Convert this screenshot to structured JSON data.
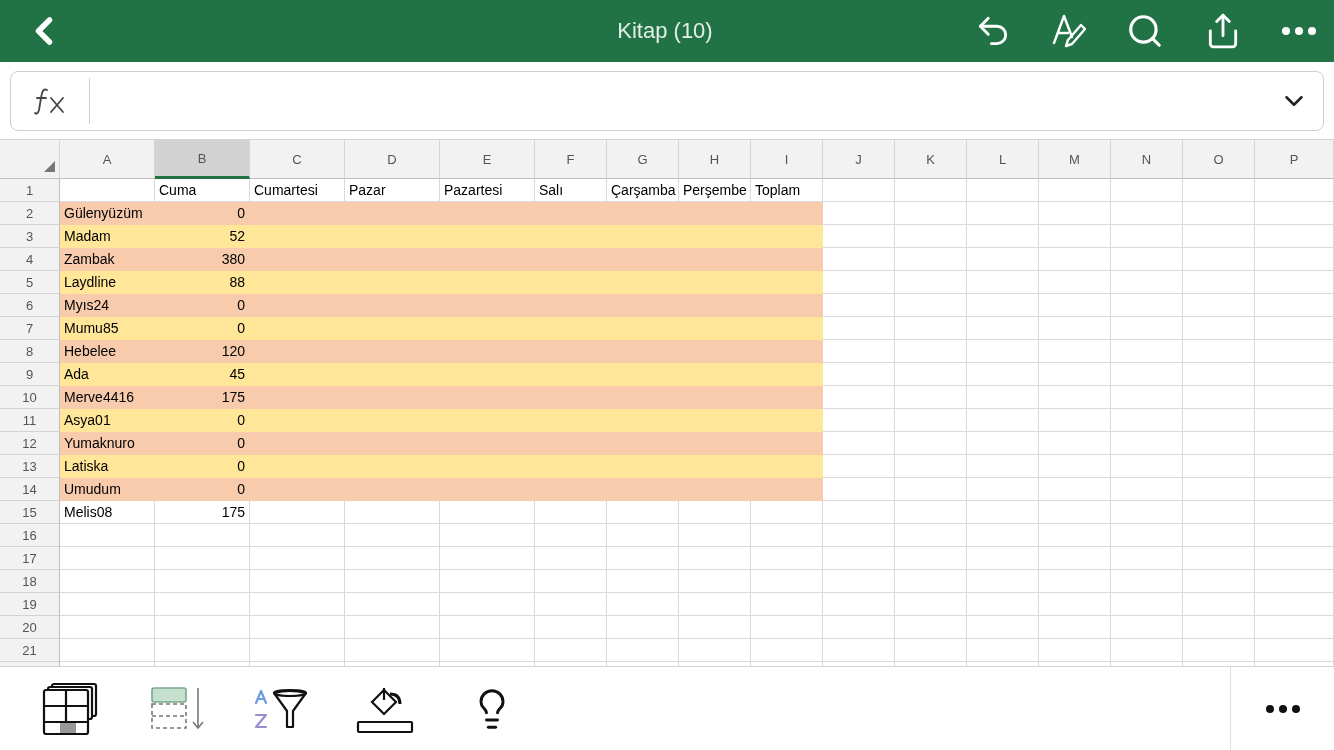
{
  "title": "Kitap (10)",
  "columns": [
    {
      "label": "A",
      "selected": false
    },
    {
      "label": "B",
      "selected": true
    },
    {
      "label": "C",
      "selected": false
    },
    {
      "label": "D",
      "selected": false
    },
    {
      "label": "E",
      "selected": false
    },
    {
      "label": "F",
      "selected": false
    },
    {
      "label": "G",
      "selected": false
    },
    {
      "label": "H",
      "selected": false
    },
    {
      "label": "I",
      "selected": false
    },
    {
      "label": "J",
      "selected": false
    },
    {
      "label": "K",
      "selected": false
    },
    {
      "label": "L",
      "selected": false
    },
    {
      "label": "M",
      "selected": false
    },
    {
      "label": "N",
      "selected": false
    },
    {
      "label": "O",
      "selected": false
    },
    {
      "label": "P",
      "selected": false
    }
  ],
  "header_row": {
    "number": "1",
    "labels": [
      "Cuma",
      "Cumartesi",
      "Pazar",
      "Pazartesi",
      "Salı",
      "Çarşamba",
      "Perşembe",
      "Toplam"
    ]
  },
  "rows": [
    {
      "number": "2",
      "color": "#f8cbad",
      "name": "Gülenyüzüm",
      "value": "0"
    },
    {
      "number": "3",
      "color": "#ffe699",
      "name": "Madam",
      "value": "52"
    },
    {
      "number": "4",
      "color": "#f8cbad",
      "name": "Zambak",
      "value": "380"
    },
    {
      "number": "5",
      "color": "#ffe699",
      "name": "Laydline",
      "value": "88"
    },
    {
      "number": "6",
      "color": "#f8cbad",
      "name": "Myıs24",
      "value": "0"
    },
    {
      "number": "7",
      "color": "#ffe699",
      "name": "Mumu85",
      "value": "0"
    },
    {
      "number": "8",
      "color": "#f8cbad",
      "name": "Hebelee",
      "value": "120"
    },
    {
      "number": "9",
      "color": "#ffe699",
      "name": "Ada",
      "value": "45"
    },
    {
      "number": "10",
      "color": "#f8cbad",
      "name": "Merve4416",
      "value": "175"
    },
    {
      "number": "11",
      "color": "#ffe699",
      "name": "Asya01",
      "value": "0"
    },
    {
      "number": "12",
      "color": "#f8cbad",
      "name": "Yumaknuro",
      "value": "0"
    },
    {
      "number": "13",
      "color": "#ffe699",
      "name": "Latiska",
      "value": "0"
    },
    {
      "number": "14",
      "color": "#f8cbad",
      "name": "Umudum",
      "value": "0"
    },
    {
      "number": "15",
      "name": "Melis08",
      "value": "175"
    },
    {
      "number": "16"
    },
    {
      "number": "17"
    },
    {
      "number": "18"
    },
    {
      "number": "19"
    },
    {
      "number": "20"
    },
    {
      "number": "21"
    }
  ]
}
